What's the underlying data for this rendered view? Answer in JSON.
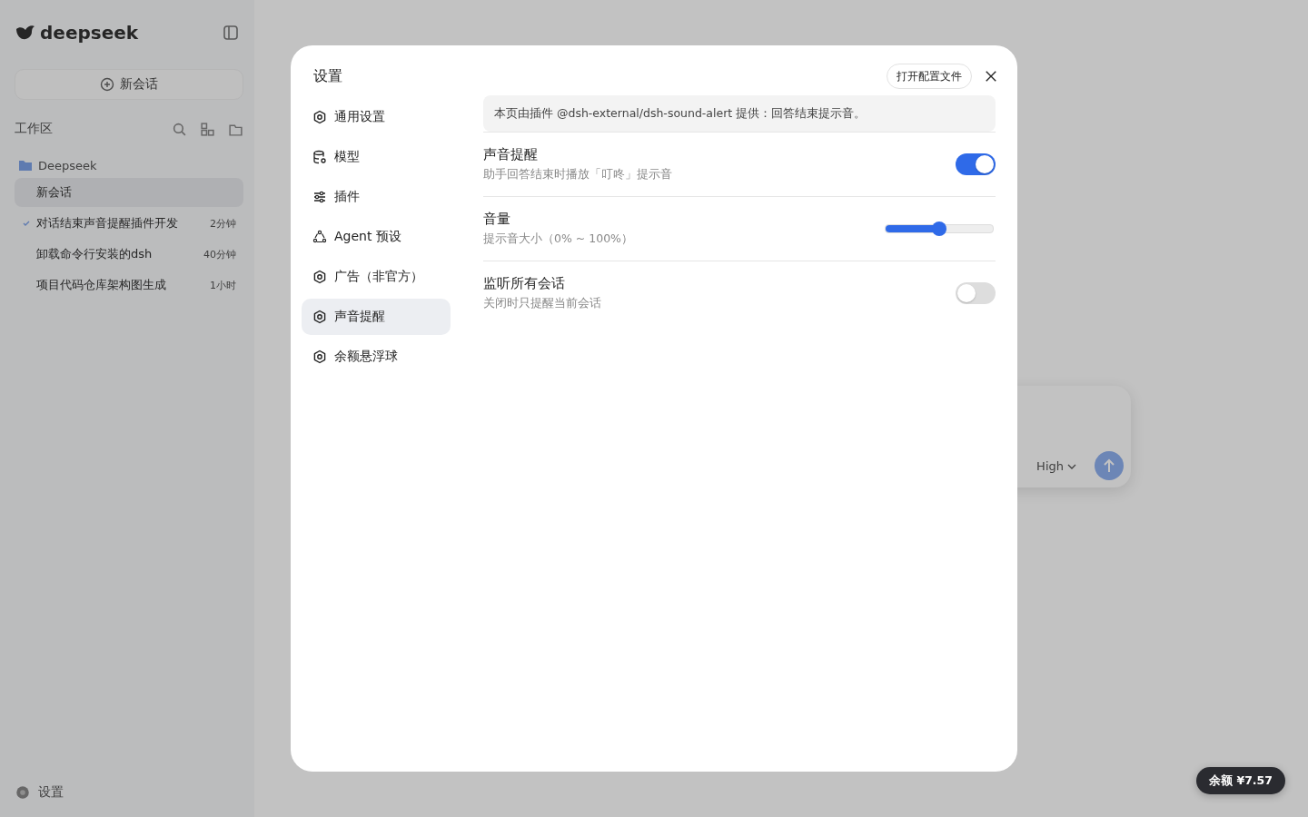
{
  "background": {
    "sidebar": {
      "logo": "deepseek",
      "new_chat": "新会话",
      "workspace_label": "工作区",
      "folder": "Deepseek",
      "items": [
        {
          "title": "新会话",
          "selected": true,
          "marked": false
        },
        {
          "title": "对话结束声音提醒插件开发",
          "time": "2分钟",
          "selected": false,
          "marked": true
        },
        {
          "title": "卸载命令行安装的dsh",
          "time": "40分钟",
          "selected": false,
          "marked": false
        },
        {
          "title": "项目代码仓库架构图生成",
          "time": "1小时",
          "selected": false,
          "marked": false
        }
      ],
      "footer": "设置"
    },
    "composer": {
      "effort": "High"
    }
  },
  "dialog": {
    "title": "设置",
    "open_config_button": "打开配置文件",
    "nav": [
      {
        "label": "通用设置",
        "selected": false
      },
      {
        "label": "模型",
        "selected": false
      },
      {
        "label": "插件",
        "selected": false
      },
      {
        "label": "Agent 预设",
        "selected": false
      },
      {
        "label": "广告（非官方）",
        "selected": false
      },
      {
        "label": "声音提醒",
        "selected": true
      },
      {
        "label": "余额悬浮球",
        "selected": false
      }
    ],
    "notice": "本页由插件 @dsh-external/dsh-sound-alert 提供：回答结束提示音。",
    "settings": [
      {
        "kind": "toggle",
        "title": "声音提醒",
        "description": "助手回答结束时播放「叮咚」提示音",
        "on": true
      },
      {
        "kind": "slider",
        "title": "音量",
        "description": "提示音大小（0% ~ 100%）",
        "level": 0.5
      },
      {
        "kind": "toggle",
        "title": "监听所有会话",
        "description": "关闭时只提醒当前会话",
        "on": false
      }
    ]
  },
  "balance_badge": "余额 ¥7.57"
}
